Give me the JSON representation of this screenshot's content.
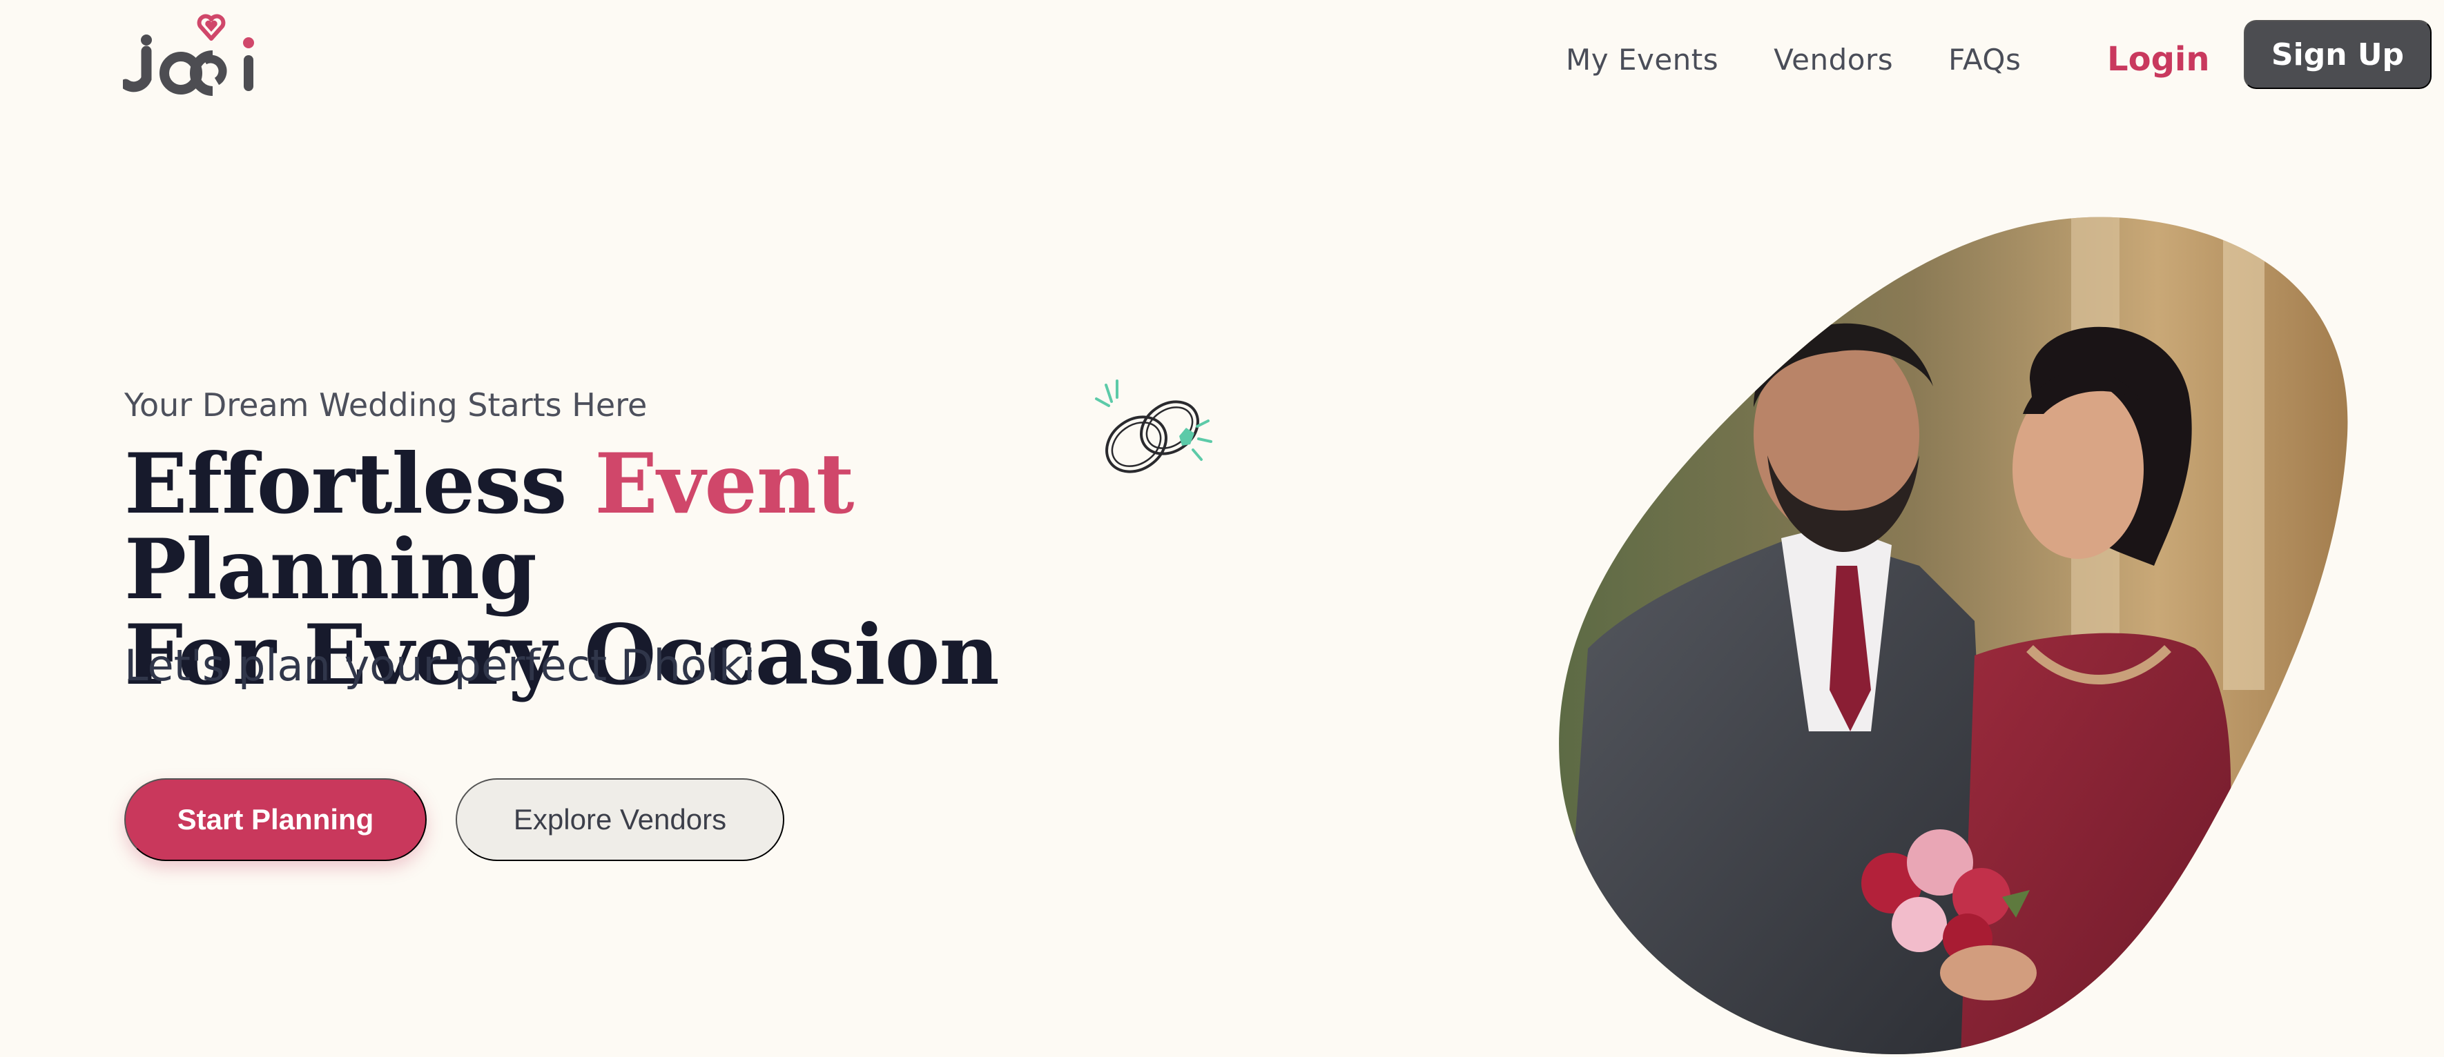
{
  "header": {
    "logo_text": "jodi",
    "nav": [
      {
        "label": "My Events"
      },
      {
        "label": "Vendors"
      },
      {
        "label": "FAQs"
      }
    ],
    "login_label": "Login",
    "signup_label": "Sign Up"
  },
  "hero": {
    "eyebrow": "Your Dream Wedding Starts Here",
    "headline_part1": "Effortless ",
    "headline_accent": "Event",
    "headline_part2": " Planning",
    "headline_line2": "For Every Occasion",
    "subline": "Let's plan your perfect Dholki",
    "primary_cta": "Start Planning",
    "secondary_cta": "Explore Vendors"
  },
  "colors": {
    "background": "#fdfaf4",
    "accent": "#c9385c",
    "dark_button": "#4c4d51",
    "ring_accent": "#5ccaa8"
  },
  "icons": [
    "heart-icon",
    "wedding-rings-icon"
  ]
}
